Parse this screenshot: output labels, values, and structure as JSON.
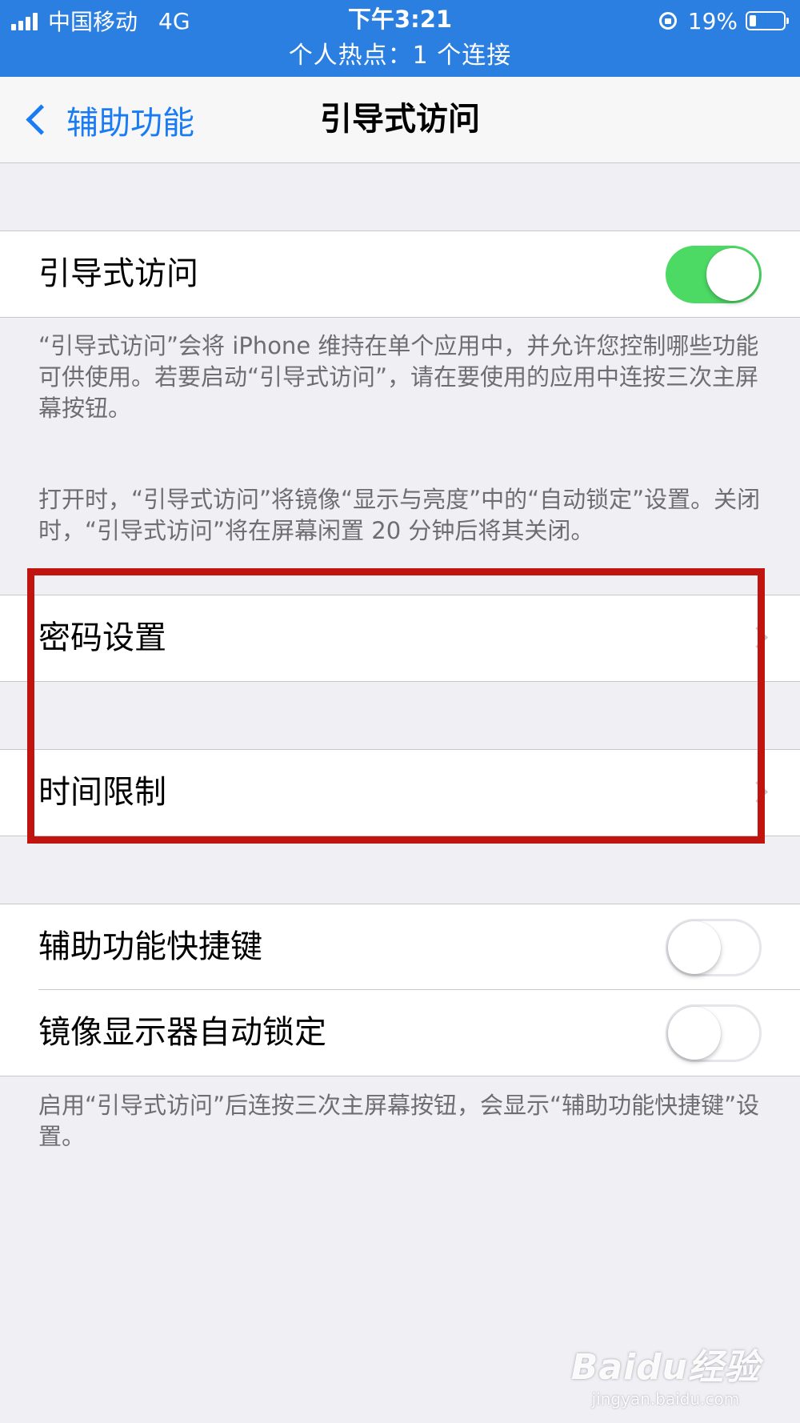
{
  "status_bar": {
    "carrier": "中国移动",
    "network": "4G",
    "time": "下午3:21",
    "battery_percent": "19%",
    "battery_level": 0.19,
    "hotspot_text": "个人热点：1 个连接",
    "bar_color": "#2a7fe0"
  },
  "nav": {
    "back_label": "辅助功能",
    "title": "引导式访问"
  },
  "main_toggle": {
    "label": "引导式访问",
    "on": true
  },
  "description_1": "“引导式访问”会将 iPhone 维持在单个应用中，并允许您控制哪些功能可供使用。若要启动“引导式访问”，请在要使用的应用中连按三次主屏幕按钮。",
  "description_2": "打开时，“引导式访问”将镜像“显示与亮度”中的“自动锁定”设置。关闭时，“引导式访问”将在屏幕闲置 20 分钟后将其关闭。",
  "passcode_row": {
    "label": "密码设置"
  },
  "time_limit_row": {
    "label": "时间限制"
  },
  "shortcut_row": {
    "label": "辅助功能快捷键",
    "on": false
  },
  "mirror_lock_row": {
    "label": "镜像显示器自动锁定",
    "on": false
  },
  "footer_note": "启用“引导式访问”后连按三次主屏幕按钮，会显示“辅助功能快捷键”设置。",
  "watermark": {
    "logo": "Baidu经验",
    "url": "jingyan.baidu.com"
  },
  "colors": {
    "accent": "#1a7cf5",
    "toggle_on": "#4cd964",
    "highlight": "#c0140e"
  }
}
